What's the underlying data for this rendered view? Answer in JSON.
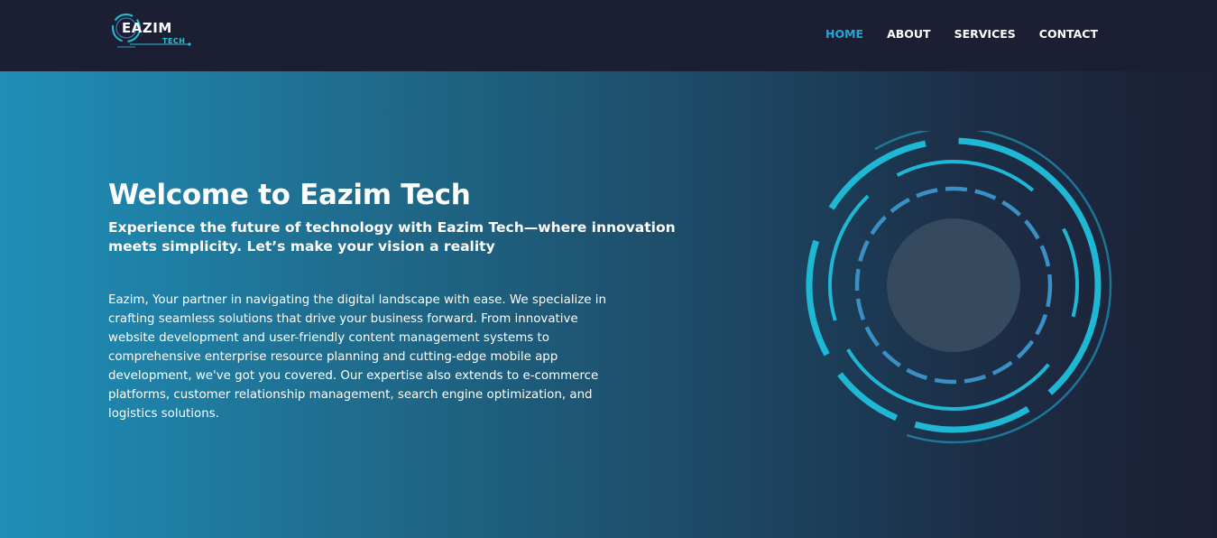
{
  "header": {
    "logo": {
      "main": "EAZIM",
      "sub": "TECH"
    },
    "nav": [
      {
        "label": "HOME",
        "active": true
      },
      {
        "label": "ABOUT",
        "active": false
      },
      {
        "label": "SERVICES",
        "active": false
      },
      {
        "label": "CONTACT",
        "active": false
      }
    ]
  },
  "hero": {
    "title": "Welcome to Eazim Tech",
    "subtitle": "Experience the future of technology with Eazim Tech—where innovation meets simplicity. Let’s make your vision a reality",
    "body": "Eazim, Your partner in navigating the digital landscape with ease. We specialize in crafting seamless solutions that drive your business forward. From innovative website development and user-friendly content management systems to comprehensive enterprise resource planning and cutting-edge mobile app development, we've got you covered. Our expertise also extends to e-commerce platforms, customer relationship management, search engine optimization, and logistics solutions."
  },
  "colors": {
    "header_bg": "#1c1f33",
    "nav_active": "#1fa7da",
    "accent_cyan": "#1fc3d6",
    "ring_blue": "#3a8fc4",
    "core_gray": "#354a5f"
  },
  "icons": {
    "hero_graphic": "tech-rings-icon"
  }
}
